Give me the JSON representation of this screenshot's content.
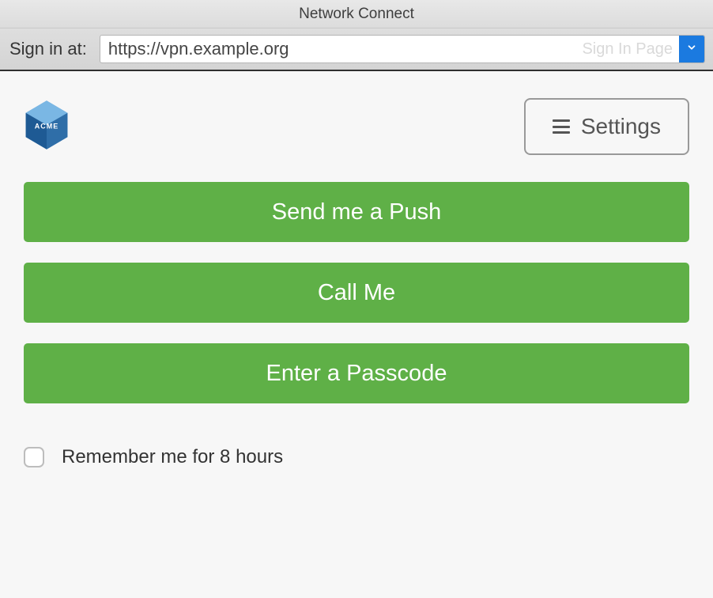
{
  "window": {
    "title": "Network Connect"
  },
  "signin": {
    "label": "Sign in at:",
    "url_value": "https://vpn.example.org",
    "ghost_button_label": "Sign In Page"
  },
  "logo": {
    "text": "ACME"
  },
  "settings": {
    "label": "Settings"
  },
  "actions": {
    "push_label": "Send me a Push",
    "call_label": "Call Me",
    "passcode_label": "Enter a Passcode"
  },
  "remember": {
    "label": "Remember me for 8 hours",
    "checked": false
  },
  "colors": {
    "accent_green": "#5fb047",
    "chevron_blue": "#1b7ae0"
  }
}
